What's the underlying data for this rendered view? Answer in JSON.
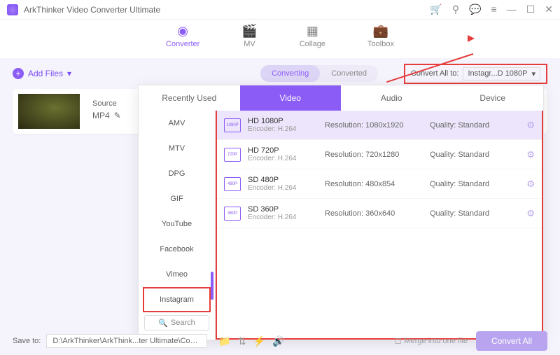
{
  "titlebar": {
    "title": "ArkThinker Video Converter Ultimate"
  },
  "nav": {
    "converter": "Converter",
    "mv": "MV",
    "collage": "Collage",
    "toolbox": "Toolbox"
  },
  "toolbar": {
    "add_files": "Add Files",
    "converting": "Converting",
    "converted": "Converted",
    "convert_all_to": "Convert All to:",
    "convert_all_value": "Instagr...D 1080P"
  },
  "file": {
    "source_label": "Source",
    "format": "MP4"
  },
  "panel": {
    "tabs": {
      "recently_used": "Recently Used",
      "video": "Video",
      "audio": "Audio",
      "device": "Device"
    },
    "sidebar": {
      "items": [
        "AMV",
        "MTV",
        "DPG",
        "GIF",
        "YouTube",
        "Facebook",
        "Vimeo",
        "Instagram"
      ],
      "search": "Search"
    },
    "formats": [
      {
        "name": "HD 1080P",
        "encoder": "Encoder: H.264",
        "resolution": "Resolution: 1080x1920",
        "quality": "Quality: Standard"
      },
      {
        "name": "HD 720P",
        "encoder": "Encoder: H.264",
        "resolution": "Resolution: 720x1280",
        "quality": "Quality: Standard"
      },
      {
        "name": "SD 480P",
        "encoder": "Encoder: H.264",
        "resolution": "Resolution: 480x854",
        "quality": "Quality: Standard"
      },
      {
        "name": "SD 360P",
        "encoder": "Encoder: H.264",
        "resolution": "Resolution: 360x640",
        "quality": "Quality: Standard"
      }
    ]
  },
  "bottom": {
    "save_to": "Save to:",
    "path": "D:\\ArkThinker\\ArkThink...ter Ultimate\\Converted",
    "merge": "Merge into one file",
    "convert": "Convert All"
  }
}
